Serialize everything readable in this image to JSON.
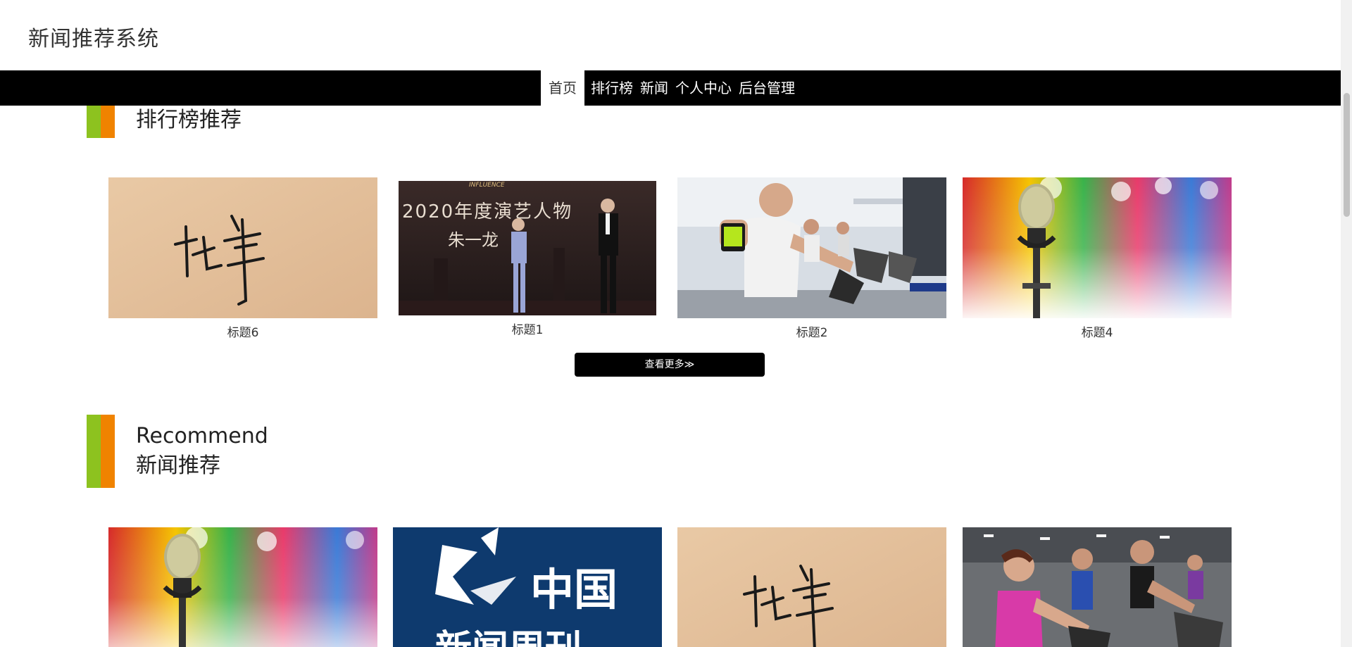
{
  "header": {
    "site_title": "新闻推荐系统"
  },
  "nav": {
    "items": [
      {
        "label": "首页",
        "active": true
      },
      {
        "label": "排行榜",
        "active": false
      },
      {
        "label": "新闻",
        "active": false
      },
      {
        "label": "个人中心",
        "active": false
      },
      {
        "label": "后台管理",
        "active": false
      }
    ]
  },
  "ranking": {
    "heading": "排行榜推荐",
    "cards": [
      {
        "title": "标题6",
        "image": "calligraphy-story-image",
        "image_text": "故事"
      },
      {
        "title": "标题1",
        "image": "award-ceremony-image",
        "image_text": "2020年度演艺人物",
        "image_text2": "朱一龙",
        "image_text3": "INFLUENCE"
      },
      {
        "title": "标题2",
        "image": "gym-cycling-image"
      },
      {
        "title": "标题4",
        "image": "microphone-stage-image"
      }
    ],
    "more_label": "查看更多≫"
  },
  "news": {
    "heading_en": "Recommend",
    "heading_cn": "新闻推荐",
    "cards": [
      {
        "image": "microphone-stage-image"
      },
      {
        "image": "china-news-weekly-image",
        "image_text": "中国",
        "image_text2": "新闻周刊"
      },
      {
        "image": "calligraphy-story-image",
        "image_text": "故事"
      },
      {
        "image": "gym-fitness-image"
      }
    ]
  },
  "colors": {
    "nav_bg": "#000000",
    "accent_green": "#8dc21f",
    "accent_orange": "#f08300",
    "button_bg": "#000000"
  }
}
